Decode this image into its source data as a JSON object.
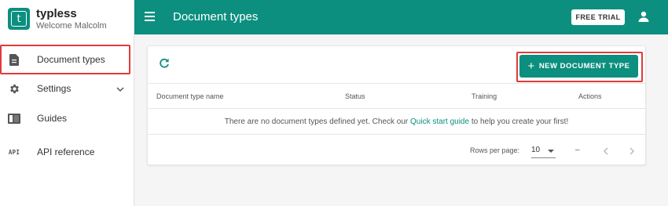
{
  "brand": {
    "name": "typless",
    "welcome": "Welcome Malcolm",
    "logo_letter": "t"
  },
  "sidebar": {
    "items": [
      {
        "label": "Document types",
        "icon": "document-icon"
      },
      {
        "label": "Settings",
        "icon": "gear-icon"
      },
      {
        "label": "Guides",
        "icon": "book-icon"
      },
      {
        "label": "API reference",
        "icon": "api-icon",
        "icon_text": "API"
      }
    ]
  },
  "topbar": {
    "title": "Document types",
    "trial_label": "FREE TRIAL"
  },
  "card": {
    "new_button_label": "NEW DOCUMENT TYPE",
    "columns": [
      "Document type name",
      "Status",
      "Training",
      "Actions"
    ],
    "empty_message": {
      "before": "There are no document types defined yet. Check our ",
      "link": "Quick start guide",
      "after": " to help you create your first!"
    },
    "pagination": {
      "rows_per_page_label": "Rows per page:",
      "rows_per_page_value": "10",
      "range": "–"
    }
  },
  "colors": {
    "accent": "#0c8f7f",
    "highlight": "#e03a3a"
  }
}
